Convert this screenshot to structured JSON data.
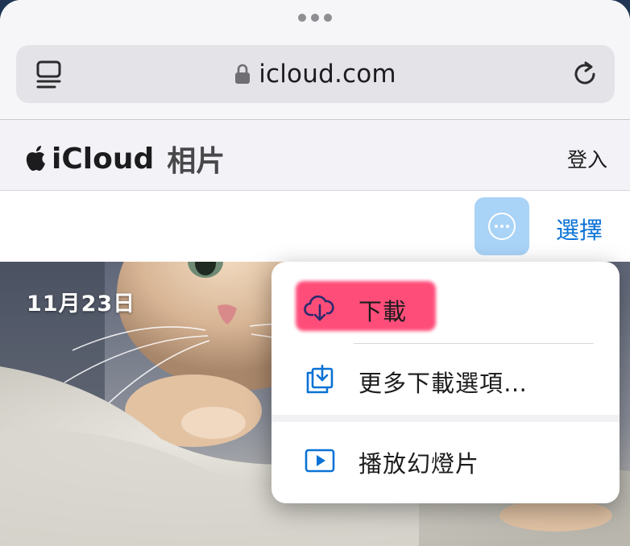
{
  "browser": {
    "url": "icloud.com",
    "icons": {
      "reader": "reader-mode-icon",
      "lock": "lock-icon",
      "reload": "reload-icon"
    }
  },
  "header": {
    "brand": "iCloud",
    "subtitle": "相片",
    "signin": "登入"
  },
  "toolbar": {
    "select_label": "選擇",
    "more_icon": "ellipsis-circle-icon"
  },
  "photo": {
    "date": "11月23日"
  },
  "menu": {
    "items": [
      {
        "label": "下載",
        "icon": "cloud-download-icon",
        "highlighted": true
      },
      {
        "label": "更多下載選項…",
        "icon": "download-tray-icon"
      },
      {
        "label": "播放幻燈片",
        "icon": "play-slideshow-icon"
      }
    ]
  },
  "colors": {
    "accent": "#0a72d6",
    "more_button_bg": "#a9d3f7",
    "highlight": "#ff2e63"
  }
}
